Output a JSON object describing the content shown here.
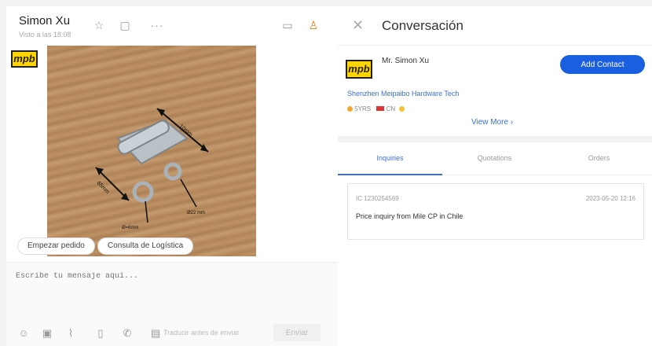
{
  "chat": {
    "contact_name": "Simon Xu",
    "contact_sub": "Visto a las 18:08",
    "avatar_text": "mpb",
    "quick_replies": [
      "Empezar pedido",
      "Consulta de Logística"
    ],
    "composer_placeholder": "Escribe tu mensaje aquí...",
    "translate_label": "Traducir antes de enviar",
    "send_label": "Enviar"
  },
  "conversation": {
    "title": "Conversación",
    "logo_text": "mpb",
    "contact_name": "Mr. Simon Xu",
    "add_contact_label": "Add Contact",
    "company": "Shenzhen Meipaibo Hardware Tech",
    "badges": {
      "years": "5YRS",
      "country": "CN"
    },
    "view_more": "View More ›",
    "tabs": [
      "Inquiries",
      "Quotations",
      "Orders"
    ],
    "inquiry": {
      "id": "IC 1230254569",
      "date": "2023-05-20 12:16",
      "text": "Price inquiry from Mile CP in Chile"
    }
  },
  "colors": {
    "accent_blue": "#1a5fe0",
    "link_blue": "#3a6fd8",
    "orange": "#f07d17"
  },
  "photo_annotations": [
    "10mm",
    "65mm",
    "Ø22 mm",
    "Ø=6mm"
  ]
}
